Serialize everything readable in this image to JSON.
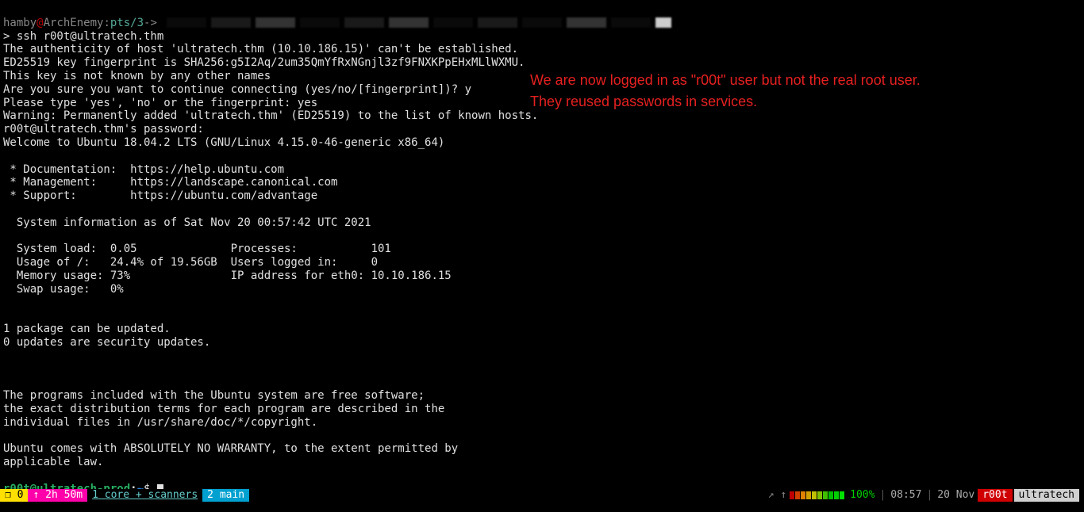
{
  "top": {
    "user": "hamby",
    "at": "@",
    "host": "ArchEnemy",
    "colon": ":",
    "pts": "pts/3",
    "arrow": "->"
  },
  "cmd": {
    "prompt": "> ",
    "text": "ssh r00t@ultratech.thm"
  },
  "lines": {
    "l1": "The authenticity of host 'ultratech.thm (10.10.186.15)' can't be established.",
    "l2": "ED25519 key fingerprint is SHA256:g5I2Aq/2um35QmYfRxNGnjl3zf9FNXKPpEHxMLlWXMU.",
    "l3": "This key is not known by any other names",
    "l4": "Are you sure you want to continue connecting (yes/no/[fingerprint])? y",
    "l5": "Please type 'yes', 'no' or the fingerprint: yes",
    "l6": "Warning: Permanently added 'ultratech.thm' (ED25519) to the list of known hosts.",
    "l7": "r00t@ultratech.thm's password:",
    "l8": "Welcome to Ubuntu 18.04.2 LTS (GNU/Linux 4.15.0-46-generic x86_64)",
    "l9": " * Documentation:  https://help.ubuntu.com",
    "l10": " * Management:     https://landscape.canonical.com",
    "l11": " * Support:        https://ubuntu.com/advantage",
    "l12": "  System information as of Sat Nov 20 00:57:42 UTC 2021",
    "l13": "  System load:  0.05              Processes:           101",
    "l14": "  Usage of /:   24.4% of 19.56GB  Users logged in:     0",
    "l15": "  Memory usage: 73%               IP address for eth0: 10.10.186.15",
    "l16": "  Swap usage:   0%",
    "l17": "1 package can be updated.",
    "l18": "0 updates are security updates.",
    "l19": "The programs included with the Ubuntu system are free software;",
    "l20": "the exact distribution terms for each program are described in the",
    "l21": "individual files in /usr/share/doc/*/copyright.",
    "l22": "Ubuntu comes with ABSOLUTELY NO WARRANTY, to the extent permitted by",
    "l23": "applicable law."
  },
  "shell": {
    "user_host": "r00t@ultratech-prod",
    "colon": ":",
    "path": "~",
    "dollar": "$ "
  },
  "annotation": {
    "line1": "We are now logged in as \"r00t\" user but not the real root user.",
    "line2": "They reused passwords in services."
  },
  "status": {
    "session": "❐ 0",
    "uptime": "↑ 2h 50m",
    "tab1": "1 core + scanners",
    "tab2": "2 main",
    "arrows": "↗ ↑",
    "cpu_colors": [
      "#c00000",
      "#d04000",
      "#e08000",
      "#d0a000",
      "#c0c000",
      "#80c000",
      "#40c000",
      "#00c000",
      "#00d000",
      "#00e000"
    ],
    "battery": "100%",
    "time": "08:57",
    "date": "20 Nov",
    "user": "r00t",
    "host": "ultratech"
  }
}
